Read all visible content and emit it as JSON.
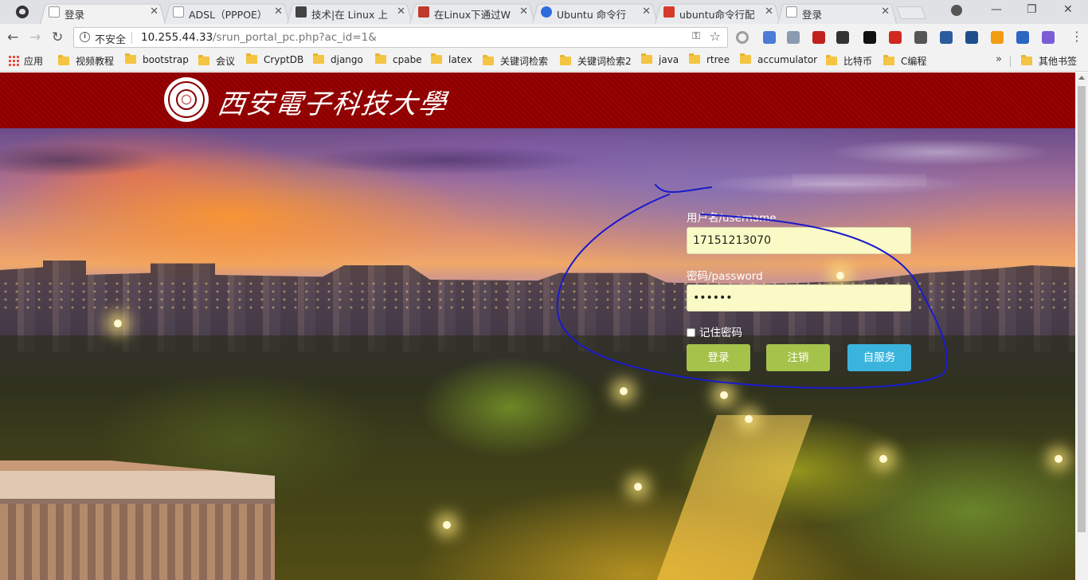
{
  "browser": {
    "tabs": [
      {
        "title": "登录",
        "active": true,
        "favicon": "page-icon",
        "color": "#9e9e9e"
      },
      {
        "title": "ADSL（PPPOE）",
        "active": false,
        "favicon": "page-icon",
        "color": "#9e9e9e"
      },
      {
        "title": "技术|在 Linux 上",
        "active": false,
        "favicon": "bookmark-site-icon",
        "color": "#444444"
      },
      {
        "title": "在Linux下通过W",
        "active": false,
        "favicon": "jb-site-icon",
        "color": "#c0392b"
      },
      {
        "title": "Ubuntu 命令行",
        "active": false,
        "favicon": "baidu-paw-icon",
        "color": "#2d6de0"
      },
      {
        "title": "ubuntu命令行配",
        "active": false,
        "favicon": "csdn-icon",
        "color": "#d63a2a"
      },
      {
        "title": "登录",
        "active": false,
        "favicon": "page-icon",
        "color": "#9e9e9e"
      }
    ],
    "address": {
      "security_label": "不安全",
      "host": "10.255.44.33",
      "path": "/srun_portal_pc.php?ac_id=1&"
    },
    "window_controls": {
      "minimize": "—",
      "maximize": "❐",
      "close": "✕"
    },
    "extension_icons": [
      {
        "name": "circle-extension-icon",
        "color": "#9e9e9e"
      },
      {
        "name": "translate-extension-icon",
        "color": "#4a7bd6"
      },
      {
        "name": "image-extension-icon",
        "color": "#8a9bb0"
      },
      {
        "name": "pdf-extension-icon",
        "color": "#c0201e"
      },
      {
        "name": "glasses-extension-icon",
        "color": "#333333"
      },
      {
        "name": "jb-extension-icon",
        "color": "#111111"
      },
      {
        "name": "acrobat-extension-icon",
        "color": "#d02a1f"
      },
      {
        "name": "globe-extension-icon",
        "color": "#555555"
      },
      {
        "name": "camera-extension-icon",
        "color": "#2b5d9e"
      },
      {
        "name": "chart-extension-icon",
        "color": "#1f4e8c"
      },
      {
        "name": "feed-extension-icon",
        "color": "#f39c12"
      },
      {
        "name": "news-extension-icon",
        "color": "#2a66c2"
      },
      {
        "name": "vee-extension-icon",
        "color": "#7b5cd6"
      }
    ],
    "bookmarks": {
      "apps_label": "应用",
      "items": [
        "视频教程",
        "bootstrap",
        "会议",
        "CryptDB",
        "django",
        "cpabe",
        "latex",
        "关键词检索",
        "关键词检索2",
        "java",
        "rtree",
        "accumulator",
        "比特币",
        "C编程"
      ],
      "more": "»",
      "other_label": "其他书签"
    }
  },
  "portal": {
    "university_name": "西安電子科技大學",
    "username_label": "用户名/username",
    "username_value": "17151213070",
    "password_label": "密码/password",
    "password_value": "••••••",
    "remember_label": "记住密码",
    "login_button": "登录",
    "logout_button": "注销",
    "self_service_button": "自服务",
    "colors": {
      "banner": "#8a0000",
      "login": "#a5c24a",
      "logout": "#a5c24a",
      "self_service": "#3bb4dd",
      "input_bg": "#fafac6",
      "annotation_ink": "#1a1acc"
    }
  }
}
